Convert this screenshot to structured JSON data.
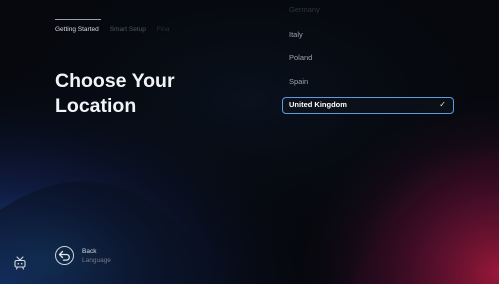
{
  "steps": {
    "active": "Getting Started",
    "next": "Smart Setup",
    "faded": "Fina"
  },
  "page_title": "Choose Your Location",
  "countries": {
    "items": [
      "Germany",
      "Italy",
      "Poland",
      "Spain",
      "United Kingdom"
    ],
    "selected": "United Kingdom"
  },
  "back": {
    "label": "Back",
    "sublabel": "Language"
  },
  "icons": {
    "back": "back-arrow-icon",
    "check": "checkmark-icon",
    "tv": "tv-logo-icon"
  },
  "colors": {
    "selection_outline": "#5b9be0",
    "background": "#07090f"
  }
}
